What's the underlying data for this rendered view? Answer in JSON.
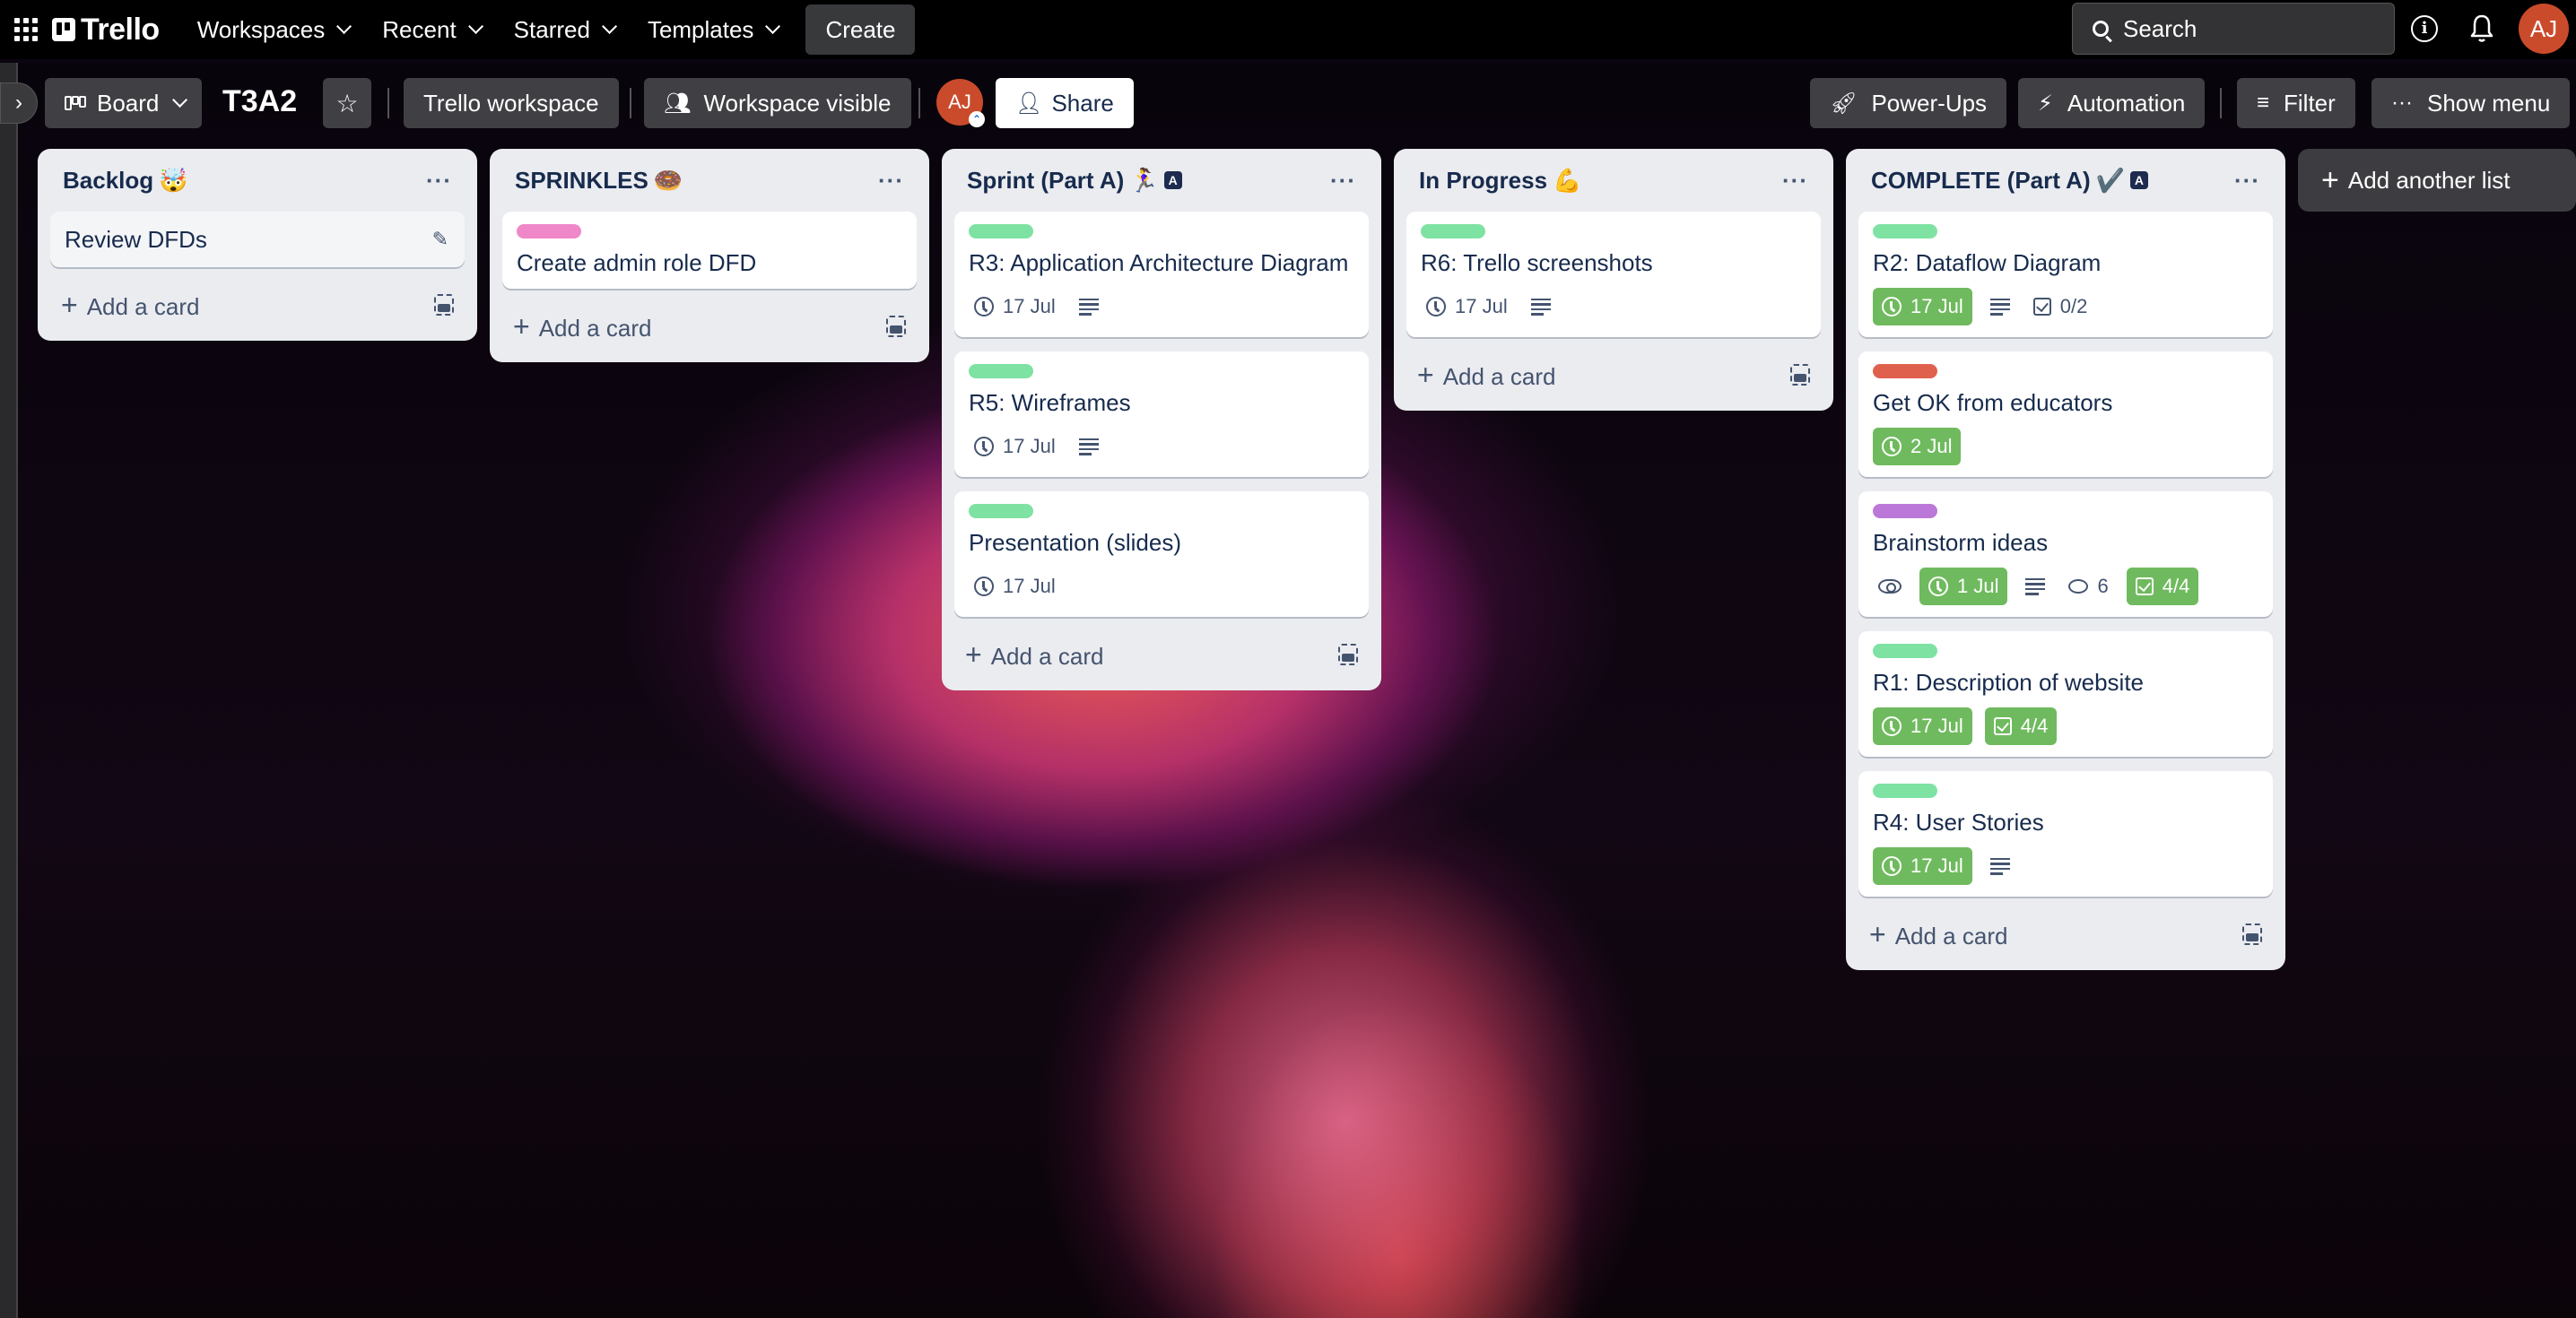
{
  "topnav": {
    "logo_text": "Trello",
    "menu": [
      {
        "label": "Workspaces"
      },
      {
        "label": "Recent"
      },
      {
        "label": "Starred"
      },
      {
        "label": "Templates"
      }
    ],
    "create_label": "Create",
    "search_placeholder": "Search",
    "avatar_initials": "AJ"
  },
  "boardbar": {
    "view_label": "Board",
    "board_title": "T3A2",
    "workspace_label": "Trello workspace",
    "visibility_label": "Workspace visible",
    "member_initials": "AJ",
    "share_label": "Share",
    "powerups_label": "Power-Ups",
    "automation_label": "Automation",
    "filter_label": "Filter",
    "show_menu_label": "Show menu"
  },
  "colors": {
    "label_green": "#7ee2a3",
    "label_pink": "#f087c9",
    "label_red": "#e0604e",
    "label_purple": "#bb78d9",
    "badge_done": "#6fba5e",
    "avatar": "#ca4b2b"
  },
  "lists": [
    {
      "title": "Backlog",
      "emoji": "🤯",
      "automation_badge": false,
      "cards": [
        {
          "title": "Review DFDs",
          "editing": true
        }
      ],
      "add_card_label": "Add a card"
    },
    {
      "title": "SPRINKLES",
      "emoji": "🍩",
      "automation_badge": false,
      "cards": [
        {
          "title": "Create admin role DFD",
          "label_color": "#f087c9"
        }
      ],
      "add_card_label": "Add a card"
    },
    {
      "title": "Sprint (Part A)",
      "emoji": "🏃‍♀️",
      "automation_badge": true,
      "cards": [
        {
          "title": "R3: Application Architecture Diagram",
          "label_color": "#7ee2a3",
          "due": "17 Jul",
          "has_description": true
        },
        {
          "title": "R5: Wireframes",
          "label_color": "#7ee2a3",
          "due": "17 Jul",
          "has_description": true
        },
        {
          "title": "Presentation (slides)",
          "label_color": "#7ee2a3",
          "due": "17 Jul"
        }
      ],
      "add_card_label": "Add a card"
    },
    {
      "title": "In Progress",
      "emoji": "💪",
      "automation_badge": false,
      "cards": [
        {
          "title": "R6: Trello screenshots",
          "label_color": "#7ee2a3",
          "due": "17 Jul",
          "has_description": true
        }
      ],
      "add_card_label": "Add a card"
    },
    {
      "title": "COMPLETE (Part A)",
      "emoji": "✔️",
      "automation_badge": true,
      "cards": [
        {
          "title": "R2: Dataflow Diagram",
          "label_color": "#7ee2a3",
          "due": "17 Jul",
          "due_complete": true,
          "has_description": true,
          "checklist": "0/2"
        },
        {
          "title": "Get OK from educators",
          "label_color": "#e0604e",
          "due": "2 Jul",
          "due_complete": true
        },
        {
          "title": "Brainstorm ideas",
          "label_color": "#bb78d9",
          "watching": true,
          "due": "1 Jul",
          "due_complete": true,
          "has_description": true,
          "comments": "6",
          "checklist": "4/4",
          "checklist_complete": true
        },
        {
          "title": "R1: Description of website",
          "label_color": "#7ee2a3",
          "due": "17 Jul",
          "due_complete": true,
          "checklist": "4/4",
          "checklist_complete": true
        },
        {
          "title": "R4: User Stories",
          "label_color": "#7ee2a3",
          "due": "17 Jul",
          "due_complete": true,
          "has_description": true
        }
      ],
      "add_card_label": "Add a card"
    }
  ],
  "add_list_label": "Add another list"
}
